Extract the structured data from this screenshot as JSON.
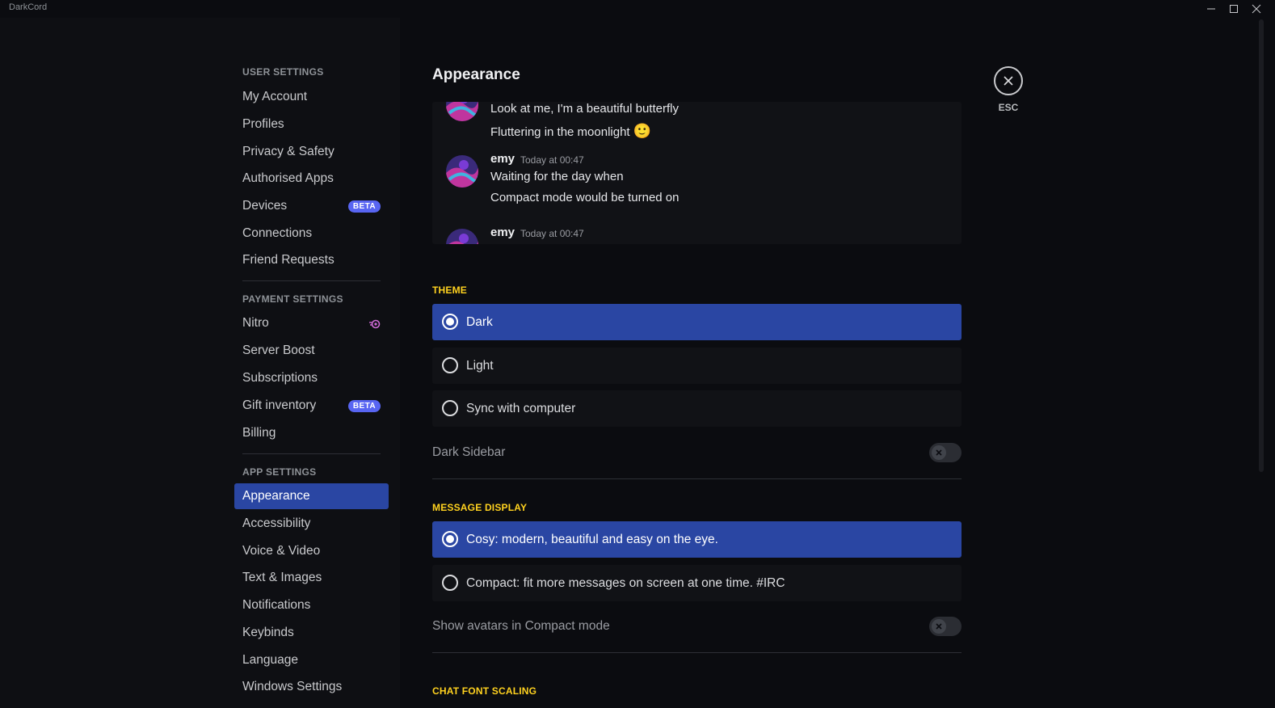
{
  "window": {
    "title": "DarkCord",
    "controls": [
      "minimize-icon",
      "maximize-icon",
      "close-icon"
    ]
  },
  "sidebar": {
    "sections": [
      {
        "header": "USER SETTINGS",
        "items": [
          {
            "label": "My Account"
          },
          {
            "label": "Profiles"
          },
          {
            "label": "Privacy & Safety"
          },
          {
            "label": "Authorised Apps"
          },
          {
            "label": "Devices",
            "badge": "BETA"
          },
          {
            "label": "Connections"
          },
          {
            "label": "Friend Requests"
          }
        ]
      },
      {
        "header": "PAYMENT SETTINGS",
        "items": [
          {
            "label": "Nitro",
            "icon": "nitro-icon"
          },
          {
            "label": "Server Boost"
          },
          {
            "label": "Subscriptions"
          },
          {
            "label": "Gift inventory",
            "badge": "BETA"
          },
          {
            "label": "Billing"
          }
        ]
      },
      {
        "header": "APP SETTINGS",
        "items": [
          {
            "label": "Appearance",
            "active": true
          },
          {
            "label": "Accessibility"
          },
          {
            "label": "Voice & Video"
          },
          {
            "label": "Text & Images"
          },
          {
            "label": "Notifications"
          },
          {
            "label": "Keybinds"
          },
          {
            "label": "Language"
          },
          {
            "label": "Windows Settings"
          }
        ]
      }
    ]
  },
  "main": {
    "title": "Appearance",
    "close_label": "ESC",
    "preview": {
      "messages": [
        {
          "lines": [
            "Look at me, I'm a beautiful butterfly",
            "Fluttering in the moonlight"
          ],
          "emoji": "🙂"
        },
        {
          "author": "emy",
          "time": "Today at 00:47",
          "lines": [
            "Waiting for the day when",
            "Compact mode would be turned on"
          ]
        },
        {
          "author": "emy",
          "time": "Today at 00:47",
          "lines": []
        }
      ]
    },
    "theme": {
      "label": "THEME",
      "options": [
        {
          "label": "Dark",
          "selected": true
        },
        {
          "label": "Light",
          "selected": false
        },
        {
          "label": "Sync with computer",
          "selected": false
        }
      ],
      "dark_sidebar": {
        "label": "Dark Sidebar",
        "enabled": false
      }
    },
    "message_display": {
      "label": "MESSAGE DISPLAY",
      "options": [
        {
          "label": "Cosy: modern, beautiful and easy on the eye.",
          "selected": true
        },
        {
          "label": "Compact: fit more messages on screen at one time. #IRC",
          "selected": false
        }
      ],
      "show_avatars": {
        "label": "Show avatars in Compact mode",
        "enabled": false
      }
    },
    "chat_font_scaling": {
      "label": "CHAT FONT SCALING"
    }
  },
  "colors": {
    "accent": "#2a46a3",
    "badge": "#5865f2",
    "section_label": "#ffd21f",
    "background": "#0b0c10",
    "sidebar": "#0e0f13"
  }
}
